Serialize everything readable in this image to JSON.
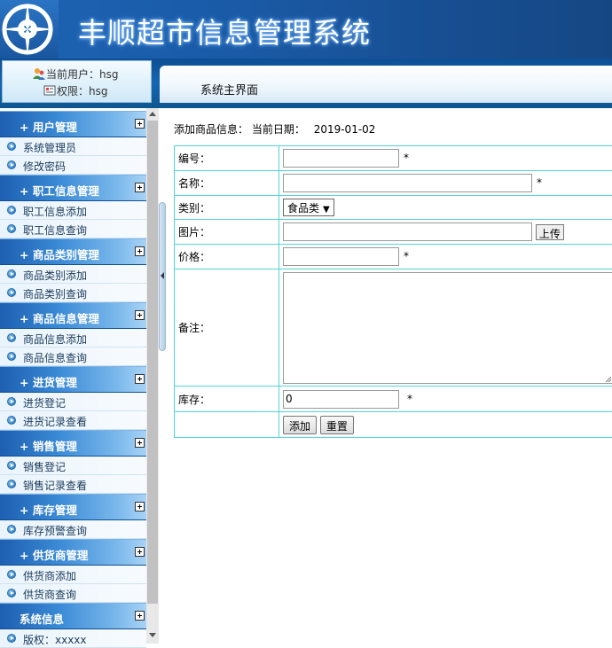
{
  "header": {
    "title": "丰顺超市信息管理系统",
    "logo_icon": "compass-logo-icon"
  },
  "user": {
    "current_user_label": "当前用户：hsg",
    "role_label": "权限：hsg"
  },
  "nav": {
    "title": "系统主界面"
  },
  "sidebar": {
    "groups": [
      {
        "title": "+ 用户管理",
        "items": [
          "系统管理员",
          "修改密码"
        ]
      },
      {
        "title": "+ 职工信息管理",
        "items": [
          "职工信息添加",
          "职工信息查询"
        ]
      },
      {
        "title": "+ 商品类别管理",
        "items": [
          "商品类别添加",
          "商品类别查询"
        ]
      },
      {
        "title": "+ 商品信息管理",
        "items": [
          "商品信息添加",
          "商品信息查询"
        ]
      },
      {
        "title": "+ 进货管理",
        "items": [
          "进货登记",
          "进货记录查看"
        ]
      },
      {
        "title": "+ 销售管理",
        "items": [
          "销售登记",
          "销售记录查看"
        ]
      },
      {
        "title": "+ 库存管理",
        "items": [
          "库存预警查询"
        ]
      },
      {
        "title": "+ 供货商管理",
        "items": [
          "供货商添加",
          "供货商查询"
        ]
      },
      {
        "title": "系统信息",
        "items": [
          "版权：xxxxx"
        ]
      }
    ]
  },
  "form": {
    "heading": "添加商品信息：",
    "date_label": "当前日期：",
    "date_value": "2019-01-02",
    "fields": {
      "code_label": "编号：",
      "name_label": "名称：",
      "category_label": "类别：",
      "category_value": "食品类",
      "image_label": "图片：",
      "upload_button": "上传",
      "price_label": "价格：",
      "remark_label": "备注：",
      "stock_label": "库存：",
      "stock_value": "0",
      "required_mark": "*"
    },
    "buttons": {
      "add": "添加",
      "reset": "重置"
    }
  },
  "colors": {
    "header_blue": "#1a5aa6",
    "menu_head_blue": "#3a8ad6",
    "table_border": "#4fd6d8"
  }
}
